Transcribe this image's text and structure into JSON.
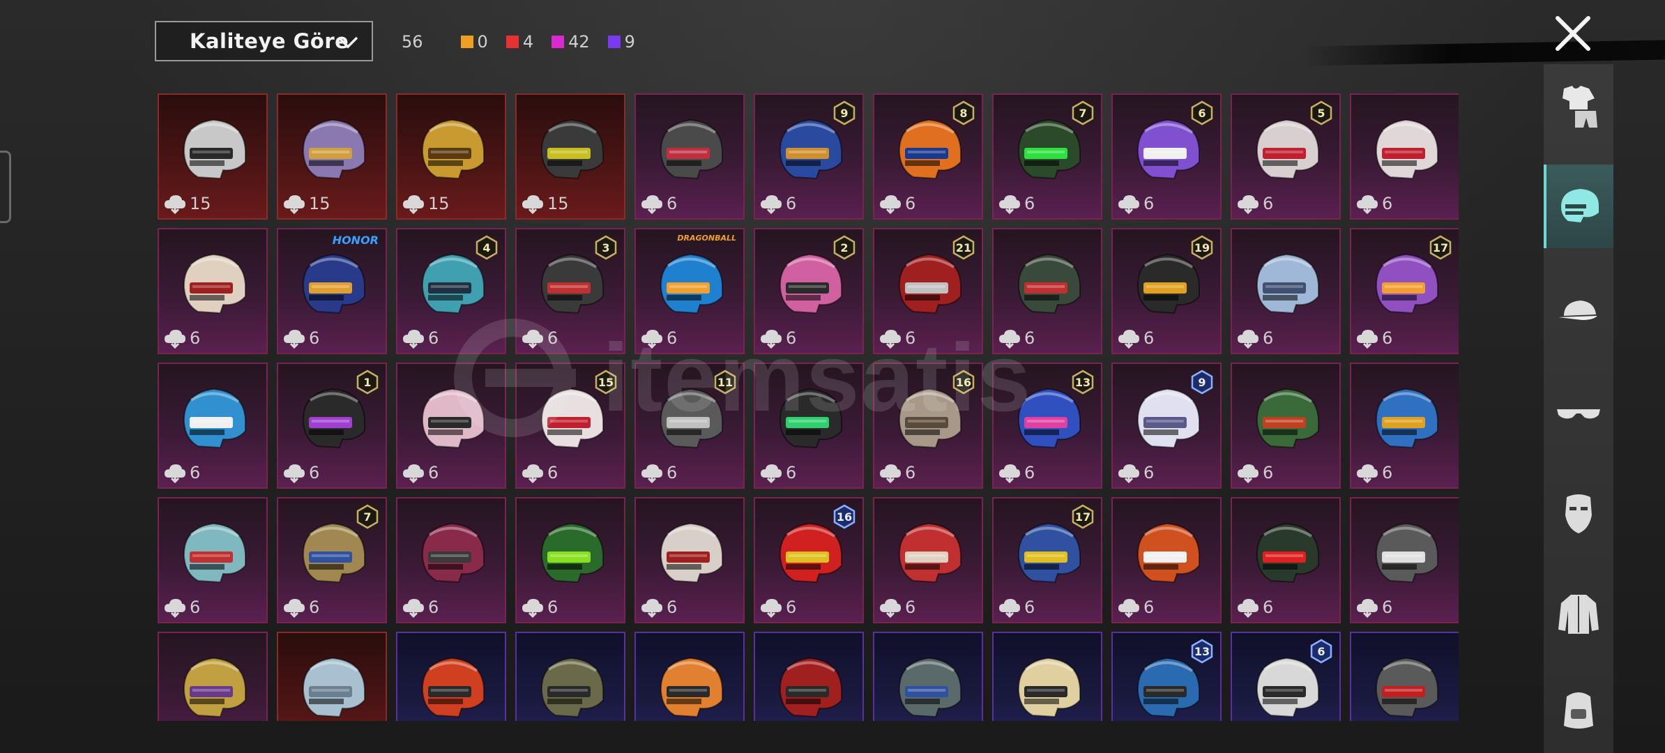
{
  "header": {
    "sort_label": "Kaliteye Göre",
    "total_count": "56",
    "quality_counts": [
      {
        "color": "#f0a020",
        "count": "0"
      },
      {
        "color": "#e83232",
        "count": "4"
      },
      {
        "color": "#d82ad0",
        "count": "42"
      },
      {
        "color": "#7a3af0",
        "count": "9"
      }
    ]
  },
  "watermark": {
    "text": "itemsatis"
  },
  "sidebar": {
    "items": [
      {
        "icon": "outfit-icon",
        "active": false
      },
      {
        "icon": "helmet-icon",
        "active": true
      },
      {
        "icon": "cap-icon",
        "active": false
      },
      {
        "icon": "glasses-icon",
        "active": false
      },
      {
        "icon": "mask-icon",
        "active": false
      },
      {
        "icon": "jacket-icon",
        "active": false
      },
      {
        "icon": "backpack-icon",
        "active": false
      }
    ]
  },
  "items": [
    {
      "quality": "red",
      "cost": "15",
      "level": "",
      "color": "#c8c8c8",
      "accent": "#2a2a2a"
    },
    {
      "quality": "red",
      "cost": "15",
      "level": "",
      "color": "#8a78b0",
      "accent": "#d0a040"
    },
    {
      "quality": "red",
      "cost": "15",
      "level": "",
      "color": "#c89a30",
      "accent": "#5a3a10"
    },
    {
      "quality": "red",
      "cost": "15",
      "level": "",
      "color": "#3a3a3a",
      "accent": "#c8c020"
    },
    {
      "quality": "pink",
      "cost": "6",
      "level": "",
      "color": "#4a4a4a",
      "accent": "#c03040"
    },
    {
      "quality": "pink",
      "cost": "6",
      "level": "9",
      "color": "#2a4aa0",
      "accent": "#d09030"
    },
    {
      "quality": "pink",
      "cost": "6",
      "level": "8",
      "color": "#e07020",
      "accent": "#1a3a90"
    },
    {
      "quality": "pink",
      "cost": "6",
      "level": "7",
      "color": "#2a4a2a",
      "accent": "#30e040"
    },
    {
      "quality": "pink",
      "cost": "6",
      "level": "6",
      "color": "#8050d0",
      "accent": "#f0f0f0"
    },
    {
      "quality": "pink",
      "cost": "6",
      "level": "5",
      "color": "#d8d0d0",
      "accent": "#c02030"
    },
    {
      "quality": "pink",
      "cost": "6",
      "level": "",
      "color": "#e0d8d8",
      "accent": "#c02030"
    },
    {
      "quality": "pink",
      "cost": "6",
      "level": "",
      "color": "#e0d0c0",
      "accent": "#a02020"
    },
    {
      "quality": "pink",
      "cost": "6",
      "level": "",
      "color": "#2a3a8a",
      "accent": "#e0a030",
      "tag": "HONOR"
    },
    {
      "quality": "pink",
      "cost": "6",
      "level": "4",
      "color": "#40a0b0",
      "accent": "#203040"
    },
    {
      "quality": "pink",
      "cost": "6",
      "level": "3",
      "color": "#3a3a3a",
      "accent": "#c03030"
    },
    {
      "quality": "pink",
      "cost": "6",
      "level": "",
      "color": "#2080d0",
      "accent": "#f0a030",
      "tag": "DRAGONBALL"
    },
    {
      "quality": "pink",
      "cost": "6",
      "level": "2",
      "color": "#d060a0",
      "accent": "#2a2a2a"
    },
    {
      "quality": "pink",
      "cost": "6",
      "level": "21",
      "color": "#a02020",
      "accent": "#c0c0c0"
    },
    {
      "quality": "pink",
      "cost": "6",
      "level": "",
      "color": "#3a4a3a",
      "accent": "#c03030"
    },
    {
      "quality": "pink",
      "cost": "6",
      "level": "19",
      "color": "#2a2a2a",
      "accent": "#e0a020"
    },
    {
      "quality": "pink",
      "cost": "6",
      "level": "",
      "color": "#a0b8d8",
      "accent": "#405070"
    },
    {
      "quality": "pink",
      "cost": "6",
      "level": "17",
      "color": "#9050c0",
      "accent": "#f0a030"
    },
    {
      "quality": "pink",
      "cost": "6",
      "level": "",
      "color": "#3090d0",
      "accent": "#f0f0f0"
    },
    {
      "quality": "pink",
      "cost": "6",
      "level": "1",
      "color": "#2a2a2a",
      "accent": "#a040d0"
    },
    {
      "quality": "pink",
      "cost": "6",
      "level": "",
      "color": "#e0b8c8",
      "accent": "#2a2a2a"
    },
    {
      "quality": "pink",
      "cost": "6",
      "level": "15",
      "color": "#e8e0e0",
      "accent": "#c02030"
    },
    {
      "quality": "pink",
      "cost": "6",
      "level": "11",
      "color": "#5a5a5a",
      "accent": "#c0c0c0"
    },
    {
      "quality": "pink",
      "cost": "6",
      "level": "",
      "color": "#2a2a2a",
      "accent": "#30d070"
    },
    {
      "quality": "pink",
      "cost": "6",
      "level": "16",
      "color": "#a89888",
      "accent": "#5a4a3a"
    },
    {
      "quality": "pink",
      "cost": "6",
      "level": "13",
      "color": "#3050c0",
      "accent": "#e040a0"
    },
    {
      "quality": "pink",
      "cost": "6",
      "level": "9",
      "color": "#e0e0f0",
      "accent": "#5a5a8a",
      "blue_badge": true
    },
    {
      "quality": "pink",
      "cost": "6",
      "level": "",
      "color": "#3a6a3a",
      "accent": "#c04020"
    },
    {
      "quality": "pink",
      "cost": "6",
      "level": "",
      "color": "#3070c0",
      "accent": "#e0a020"
    },
    {
      "quality": "pink",
      "cost": "6",
      "level": "",
      "color": "#80b8c0",
      "accent": "#c03030"
    },
    {
      "quality": "pink",
      "cost": "6",
      "level": "7",
      "color": "#a08850",
      "accent": "#3050a0"
    },
    {
      "quality": "pink",
      "cost": "6",
      "level": "",
      "color": "#8a2a4a",
      "accent": "#3a3a3a"
    },
    {
      "quality": "pink",
      "cost": "6",
      "level": "",
      "color": "#2a6a2a",
      "accent": "#8ae020"
    },
    {
      "quality": "pink",
      "cost": "6",
      "level": "",
      "color": "#d8d0c8",
      "accent": "#a02020"
    },
    {
      "quality": "pink",
      "cost": "6",
      "level": "16",
      "color": "#d02020",
      "accent": "#e0c020",
      "blue_badge": true
    },
    {
      "quality": "pink",
      "cost": "6",
      "level": "",
      "color": "#c03030",
      "accent": "#e0d0c0"
    },
    {
      "quality": "pink",
      "cost": "6",
      "level": "17",
      "color": "#3050a0",
      "accent": "#e0c020"
    },
    {
      "quality": "pink",
      "cost": "6",
      "level": "",
      "color": "#d05020",
      "accent": "#f0f0f0"
    },
    {
      "quality": "pink",
      "cost": "6",
      "level": "",
      "color": "#2a3a2a",
      "accent": "#e02020"
    },
    {
      "quality": "pink",
      "cost": "6",
      "level": "",
      "color": "#5a5a5a",
      "accent": "#e0e0e0"
    },
    {
      "quality": "pink",
      "cost": "",
      "level": "",
      "color": "#c0a040",
      "accent": "#6a3a8a"
    },
    {
      "quality": "red",
      "cost": "",
      "level": "",
      "color": "#a8c0d0",
      "accent": "#6a8090"
    },
    {
      "quality": "purple",
      "cost": "",
      "level": "",
      "color": "#d04020",
      "accent": "#2a2a2a"
    },
    {
      "quality": "purple",
      "cost": "",
      "level": "",
      "color": "#6a6a4a",
      "accent": "#2a2a2a"
    },
    {
      "quality": "purple",
      "cost": "",
      "level": "",
      "color": "#e08030",
      "accent": "#2a2a2a"
    },
    {
      "quality": "purple",
      "cost": "",
      "level": "",
      "color": "#a02020",
      "accent": "#2a2a2a"
    },
    {
      "quality": "purple",
      "cost": "",
      "level": "",
      "color": "#5a6a6a",
      "accent": "#3050a0"
    },
    {
      "quality": "purple",
      "cost": "",
      "level": "",
      "color": "#e0d0a0",
      "accent": "#2a2a2a"
    },
    {
      "quality": "purple",
      "cost": "",
      "level": "13",
      "color": "#2a6ab0",
      "accent": "#2a2a2a",
      "blue_badge": true
    },
    {
      "quality": "purple",
      "cost": "",
      "level": "6",
      "color": "#d8d8d8",
      "accent": "#2a2a2a",
      "blue_badge": true
    },
    {
      "quality": "purple",
      "cost": "",
      "level": "",
      "color": "#5a5a5a",
      "accent": "#c02020"
    }
  ]
}
